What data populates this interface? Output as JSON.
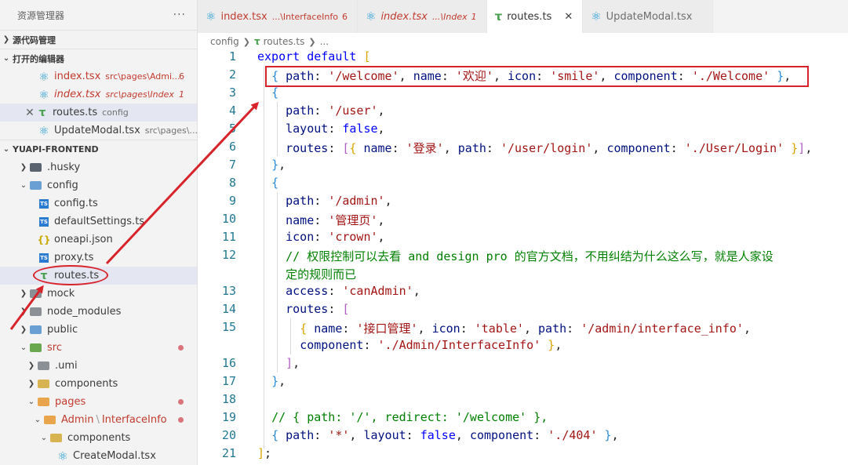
{
  "sidebar": {
    "title": "资源管理器",
    "more": "···",
    "section_scm": "源代码管理",
    "section_open_editors": "打开的编辑器",
    "open_editors": [
      {
        "name": "index.tsx",
        "desc": "src\\pages\\Admi...",
        "badge": "6"
      },
      {
        "name": "index.tsx",
        "desc": "src\\pages\\Index",
        "badge": "1"
      },
      {
        "name": "routes.ts",
        "desc": "config"
      },
      {
        "name": "UpdateModal.tsx",
        "desc": "src\\pages\\..."
      }
    ],
    "project": "YUAPI-FRONTEND",
    "tree": [
      ".husky",
      "config",
      "config.ts",
      "defaultSettings.ts",
      "oneapi.json",
      "proxy.ts",
      "routes.ts",
      "mock",
      "node_modules",
      "public",
      "src",
      ".umi",
      "components",
      "pages",
      "Admin",
      "InterfaceInfo",
      "components",
      "CreateModal.tsx"
    ]
  },
  "tabs": [
    {
      "name": "index.tsx",
      "desc": "...\\InterfaceInfo",
      "badge": "6"
    },
    {
      "name": "index.tsx",
      "desc": "...\\Index",
      "badge": "1"
    },
    {
      "name": "routes.ts",
      "close": "✕"
    },
    {
      "name": "UpdateModal.tsx"
    }
  ],
  "breadcrumb": {
    "folder": "config",
    "file": "routes.ts",
    "more": "..."
  },
  "code": {
    "line_numbers": [
      "1",
      "2",
      "3",
      "4",
      "5",
      "6",
      "7",
      "8",
      "9",
      "10",
      "11",
      "12",
      "13",
      "14",
      "15",
      "16",
      "17",
      "18",
      "19",
      "20",
      "21"
    ],
    "l1": {
      "kw1": "export",
      "kw2": "default"
    },
    "s_welcome_path": "'/welcome'",
    "s_welcome_name": "'欢迎'",
    "s_smile": "'smile'",
    "s_welcome_comp": "'./Welcome'",
    "s_user": "'/user'",
    "kw_false": "false",
    "s_login_name": "'登录'",
    "s_login_path": "'/user/login'",
    "s_login_comp": "'./User/Login'",
    "s_admin": "'/admin'",
    "s_admin_name": "'管理页'",
    "s_crown": "'crown'",
    "comment_a": "// 权限控制可以去看 and design pro 的官方文档，不用纠结为什么这么写，就是人家设",
    "comment_b": "定的规则而已",
    "s_canadmin": "'canAdmin'",
    "s_iface_name": "'接口管理'",
    "s_table": "'table'",
    "s_iface_path": "'/admin/interface_info'",
    "s_iface_comp": "'./Admin/InterfaceInfo'",
    "comment_redirect": "// { path: '/', redirect: '/welcome' },",
    "s_star": "'*'",
    "s_404": "'./404'"
  }
}
